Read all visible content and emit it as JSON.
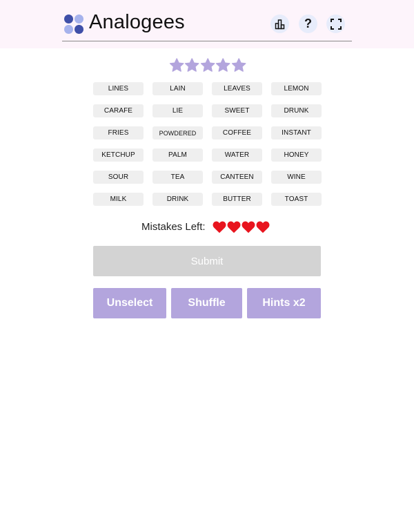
{
  "header": {
    "title": "Analogees",
    "help_label": "?",
    "icons": [
      "logo-icon",
      "stats-icon",
      "help-icon",
      "fullscreen-icon"
    ]
  },
  "colors": {
    "background_top": "#fdf4fb",
    "logo_dark": "#3f4fa8",
    "logo_light": "#a6b2ec",
    "icon_bg": "#e7ecfb",
    "star": "#b3a5dd",
    "tile": "#efefef",
    "heart": "#e8141e",
    "submit_disabled": "#d3d3d3",
    "action_button": "#b3a5dd"
  },
  "rating": {
    "stars": 5
  },
  "tiles": [
    "LINES",
    "LAIN",
    "LEAVES",
    "LEMON",
    "CARAFE",
    "LIE",
    "SWEET",
    "DRUNK",
    "FRIES",
    "POWDERED",
    "COFFEE",
    "INSTANT",
    "KETCHUP",
    "PALM",
    "WATER",
    "HONEY",
    "SOUR",
    "TEA",
    "CANTEEN",
    "WINE",
    "MILK",
    "DRINK",
    "BUTTER",
    "TOAST"
  ],
  "mistakes": {
    "label": "Mistakes Left:",
    "remaining": 4
  },
  "buttons": {
    "submit": "Submit",
    "unselect": "Unselect",
    "shuffle": "Shuffle",
    "hints": "Hints x2"
  }
}
